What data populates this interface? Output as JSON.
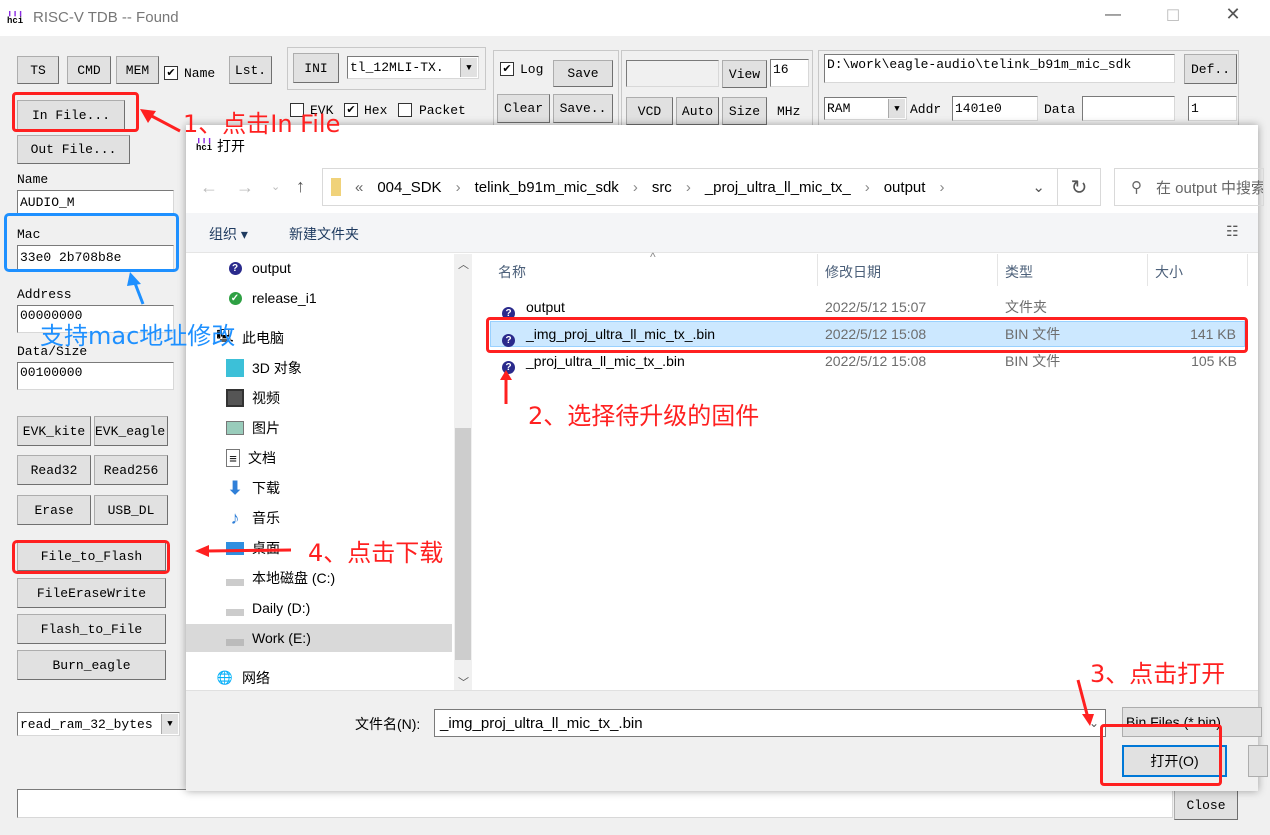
{
  "window": {
    "title": "RISC-V TDB -- Found",
    "logo": "hci",
    "controls": [
      "minimize",
      "maximize",
      "close"
    ]
  },
  "toolbar": {
    "ts": "TS",
    "cmd": "CMD",
    "mem": "MEM",
    "name_check": {
      "label": "Name",
      "checked": true
    },
    "lst": "Lst.",
    "ini": "INI",
    "ini_select": "tl_12MLI-TX.",
    "evk_check": {
      "label": "EVK",
      "checked": false
    },
    "hex_check": {
      "label": "Hex",
      "checked": true
    },
    "packet_check": {
      "label": "Packet",
      "checked": false
    },
    "log_check": {
      "label": "Log",
      "checked": true
    },
    "save": "Save",
    "clear": "Clear",
    "save_as": "Save..",
    "view": "View",
    "view_value": "16",
    "vcd": "VCD",
    "auto": "Auto",
    "size": "Size",
    "mhz": "MHz",
    "path": "D:\\work\\eagle-audio\\telink_b91m_mic_sdk",
    "def": "Def..",
    "mem_select": "RAM",
    "addr_label": "Addr",
    "addr_value": "1401e0",
    "data_label": "Data",
    "data_value": "",
    "count_value": "1"
  },
  "left": {
    "in_file": "In File...",
    "out_file": "Out File...",
    "name_label": "Name",
    "name_value": "AUDIO_M",
    "mac_label": "Mac",
    "mac_value": "33e0 2b708b8e",
    "address_label": "Address",
    "address_value": "00000000",
    "datasize_label": "Data/Size",
    "datasize_value": "00100000",
    "evk_kite": "EVK_kite",
    "evk_eagle": "EVK_eagle",
    "read32": "Read32",
    "read256": "Read256",
    "erase": "Erase",
    "usb_dl": "USB_DL",
    "file_to_flash": "File_to_Flash",
    "file_erase_write": "FileEraseWrite",
    "flash_to_file": "Flash_to_File",
    "burn_eagle": "Burn_eagle",
    "cmd_select": "read_ram_32_bytes"
  },
  "bottom": {
    "command_value": "",
    "close": "Close"
  },
  "dialog": {
    "title": "打开",
    "breadcrumb": [
      "«",
      "004_SDK",
      "telink_b91m_mic_sdk",
      "src",
      "_proj_ultra_ll_mic_tx_",
      "output"
    ],
    "search_placeholder": "在 output 中搜索",
    "organize": "组织 ▾",
    "new_folder": "新建文件夹",
    "tree": [
      {
        "label": "output",
        "icon": "folder-question-icon"
      },
      {
        "label": "release_i1",
        "icon": "folder-check-icon"
      },
      {
        "label": "此电脑",
        "icon": "computer-icon"
      },
      {
        "label": "3D 对象",
        "icon": "cube-icon"
      },
      {
        "label": "视频",
        "icon": "video-icon"
      },
      {
        "label": "图片",
        "icon": "picture-icon"
      },
      {
        "label": "文档",
        "icon": "document-icon"
      },
      {
        "label": "下载",
        "icon": "download-icon"
      },
      {
        "label": "音乐",
        "icon": "music-icon"
      },
      {
        "label": "桌面",
        "icon": "desktop-icon"
      },
      {
        "label": "本地磁盘 (C:)",
        "icon": "drive-icon"
      },
      {
        "label": "Daily (D:)",
        "icon": "drive-icon"
      },
      {
        "label": "Work (E:)",
        "icon": "drive-icon",
        "selected": true
      },
      {
        "label": "网络",
        "icon": "network-icon"
      }
    ],
    "columns": [
      "名称",
      "修改日期",
      "类型",
      "大小"
    ],
    "files": [
      {
        "name": "output",
        "date": "2022/5/12 15:07",
        "type": "文件夹",
        "size": ""
      },
      {
        "name": "_img_proj_ultra_ll_mic_tx_.bin",
        "date": "2022/5/12 15:08",
        "type": "BIN 文件",
        "size": "141 KB",
        "selected": true
      },
      {
        "name": "_proj_ultra_ll_mic_tx_.bin",
        "date": "2022/5/12 15:08",
        "type": "BIN 文件",
        "size": "105 KB"
      }
    ],
    "filename_label": "文件名(N):",
    "filename_value": "_img_proj_ultra_ll_mic_tx_.bin",
    "filter": "Bin Files (*.bin)",
    "open": "打开(O)"
  },
  "annotations": {
    "step1": "1、点击In File",
    "mac_note": "支持mac地址修改",
    "step2": "2、选择待升级的固件",
    "step3": "3、点击打开",
    "step4": "4、点击下载"
  },
  "colors": {
    "annotation_red": "#ff2020",
    "annotation_blue": "#1e90ff",
    "selection": "#cce8ff",
    "accent": "#0078d7"
  }
}
